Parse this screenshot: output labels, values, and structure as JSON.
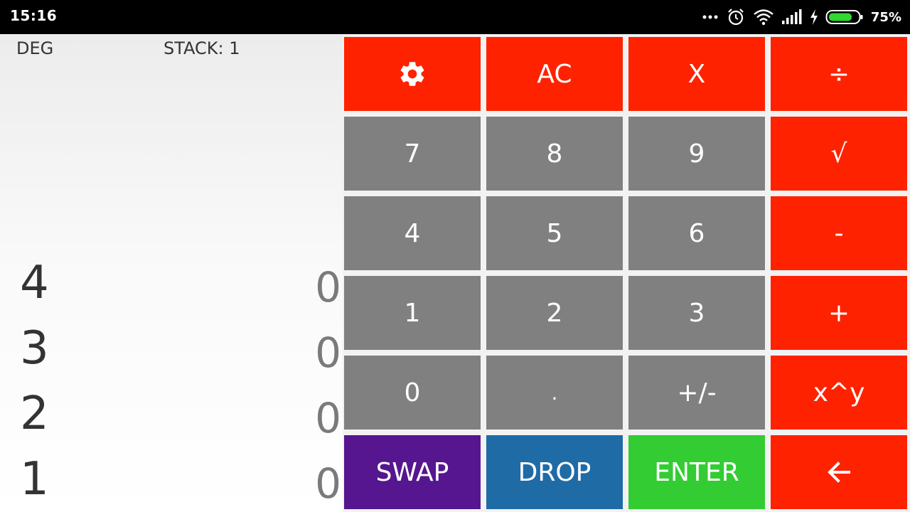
{
  "status_bar": {
    "time": "15:16",
    "battery_percent": "75%",
    "icons": [
      "more-dots-icon",
      "alarm-icon",
      "wifi-icon",
      "signal-icon",
      "charging-icon",
      "battery-icon"
    ]
  },
  "display": {
    "angle_mode": "DEG",
    "stack_label": "STACK: 1",
    "rows": [
      {
        "index": "4",
        "value": "0"
      },
      {
        "index": "3",
        "value": "0"
      },
      {
        "index": "2",
        "value": "0"
      },
      {
        "index": "1",
        "value": "0"
      }
    ]
  },
  "keypad": {
    "settings_icon": "gear-icon",
    "ac": "AC",
    "multiply": "X",
    "divide": "÷",
    "seven": "7",
    "eight": "8",
    "nine": "9",
    "sqrt": "√",
    "four": "4",
    "five": "5",
    "six": "6",
    "minus": "-",
    "one": "1",
    "two": "2",
    "three": "3",
    "plus": "+",
    "zero": "0",
    "decimal": ".",
    "negate": "+/-",
    "power": "x^y",
    "swap": "SWAP",
    "drop": "DROP",
    "enter": "ENTER",
    "backspace_icon": "arrow-left-icon"
  },
  "colors": {
    "red": "#ff2200",
    "gray": "#808080",
    "purple": "#56168f",
    "blue": "#1f6ba6",
    "green": "#33cc33"
  }
}
